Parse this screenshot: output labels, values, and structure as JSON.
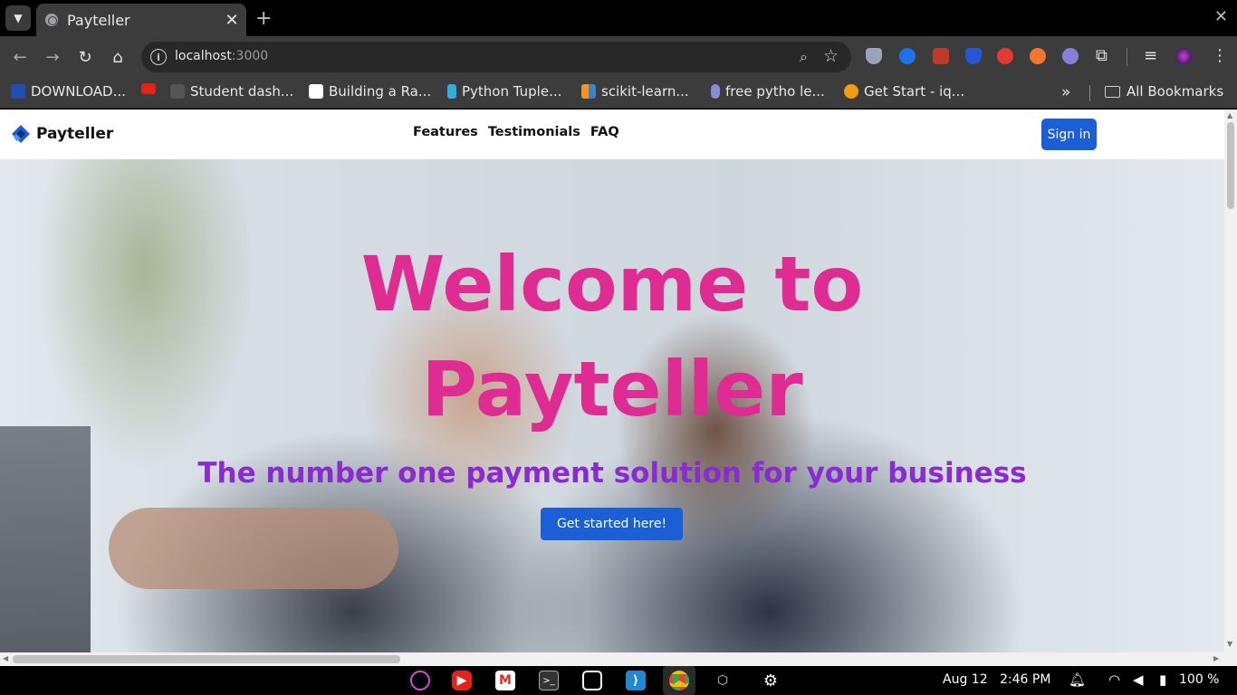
{
  "browser": {
    "tab_title": "Payteller",
    "url_host": "localhost",
    "url_port": ":3000",
    "bookmarks": [
      {
        "label": "DOWNLOAD...",
        "color": "#1f4fb5"
      },
      {
        "label": "",
        "color": "#e62117"
      },
      {
        "label": "Student dash...",
        "color": "#555555"
      },
      {
        "label": "Building a Ra...",
        "color": "#ffffff"
      },
      {
        "label": "Python Tuple...",
        "color": "#2bb0e0"
      },
      {
        "label": "scikit-learn...",
        "color": "#f7931e"
      },
      {
        "label": "free pytho le...",
        "color": "#8a8ad8"
      },
      {
        "label": "Get Start - iq...",
        "color": "#f39c12"
      }
    ],
    "more_bookmarks": "»",
    "all_bookmarks": "All Bookmarks"
  },
  "site": {
    "brand": "Payteller",
    "nav": {
      "features": "Features",
      "testimonials": "Testimonials",
      "faq": "FAQ"
    },
    "signin": "Sign in",
    "hero_line1": "Welcome to",
    "hero_line2": "Payteller",
    "subtitle": "The number one payment solution for your business",
    "cta": "Get started here!",
    "colors": {
      "title": "#df2c93",
      "subtitle": "#8a2bd2",
      "button": "#1b5fd6"
    }
  },
  "taskbar": {
    "date": "Aug 12",
    "time": "2:46 PM",
    "battery": "100 %"
  }
}
